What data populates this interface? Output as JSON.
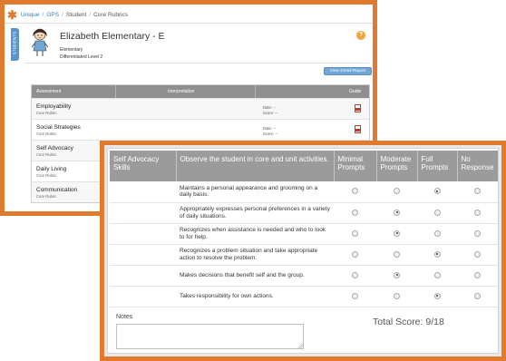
{
  "breadcrumb": {
    "items": [
      "Unique",
      "GPS",
      "Student",
      "Core Rubrics"
    ],
    "separators": [
      "/",
      "/",
      "/"
    ]
  },
  "side_tab": {
    "label": "STUDENTS"
  },
  "student": {
    "name": "Elizabeth Elementary - E",
    "level_type": "Elementary",
    "level": "Differentiated Level 2"
  },
  "help_icon": {
    "glyph": "?"
  },
  "view_report_button": "View Detail Report",
  "assessment_table": {
    "headers": {
      "assessment": "Assessment",
      "interpretation": "Interpretation",
      "guide": "Guide"
    },
    "rows": [
      {
        "name": "Employability",
        "subtitle": "Core Rubric",
        "date": "Date: --",
        "score": "Score: --"
      },
      {
        "name": "Social Strategies",
        "subtitle": "Core Rubric",
        "date": "Date: --",
        "score": "Score: --"
      },
      {
        "name": "Self Advocacy",
        "subtitle": "Core Rubric",
        "date": "",
        "score": ""
      },
      {
        "name": "Daily Living",
        "subtitle": "Core Rubric",
        "date": "",
        "score": ""
      },
      {
        "name": "Communication",
        "subtitle": "Core Rubric",
        "date": "",
        "score": ""
      }
    ]
  },
  "rubric": {
    "headers": {
      "skill": "Self Advocacy Skills",
      "observe": "Observe the student in core and unit activities.",
      "minimal": "Minimal Prompts",
      "moderate": "Moderate Prompts",
      "full": "Full Prompts",
      "none": "No Response"
    },
    "rows": [
      {
        "text": "Maintains a personal appearance and grooming on a daily basis.",
        "selected": "full"
      },
      {
        "text": "Appropriately expresses personal preferences in a variety of daily situations.",
        "selected": "moderate"
      },
      {
        "text": "Recognizes when assistance is needed and who to look to for help.",
        "selected": "moderate"
      },
      {
        "text": "Recognizes a problem situation and take appropriate action to resolve the problem.",
        "selected": "full"
      },
      {
        "text": "Makes decisions that benefit self and the group.",
        "selected": "moderate"
      },
      {
        "text": "Takes responsibility for own actions.",
        "selected": "full"
      }
    ]
  },
  "notes": {
    "label": "Notes",
    "value": ""
  },
  "total_score": "Total Score: 9/18",
  "colors": {
    "accent_orange": "#e07a2e",
    "link_blue": "#2f7fc1",
    "header_gray": "#9b9b9b"
  }
}
